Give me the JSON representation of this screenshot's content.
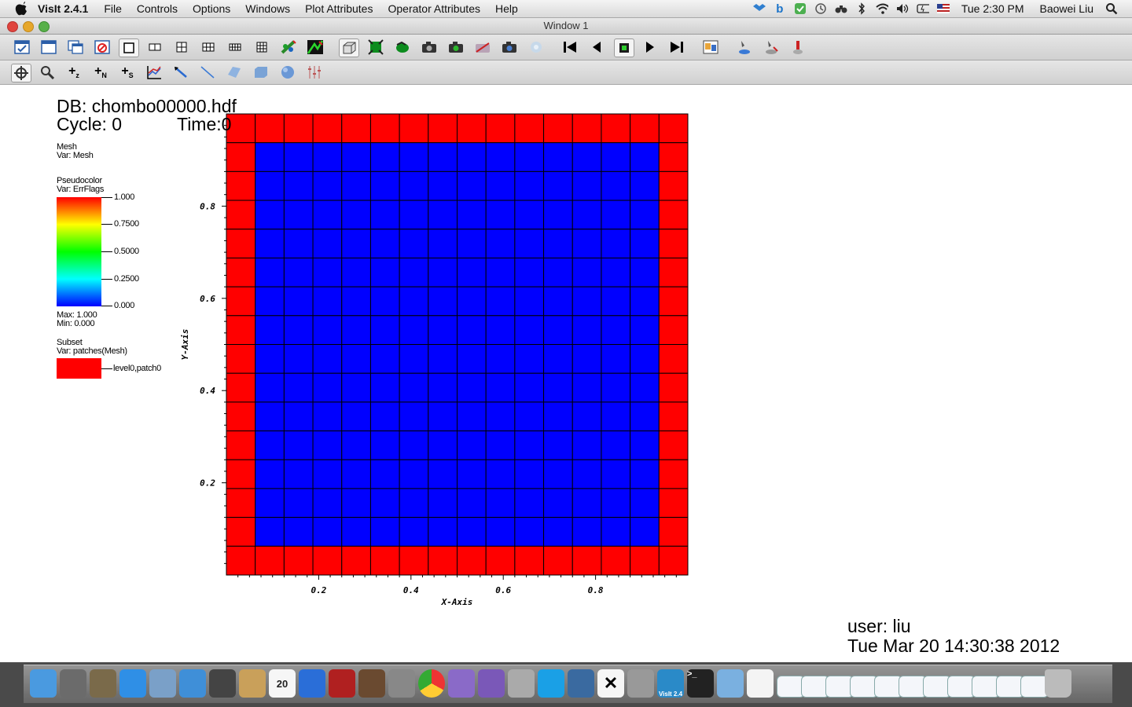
{
  "menubar": {
    "app_name": "VisIt 2.4.1",
    "items": [
      "File",
      "Controls",
      "Options",
      "Windows",
      "Plot Attributes",
      "Operator Attributes",
      "Help"
    ],
    "clock": "Tue 2:30 PM",
    "user": "Baowei Liu",
    "status_icons": [
      "dropbox-icon",
      "b-icon",
      "checkmark-icon",
      "time-machine-icon",
      "binoculars-icon",
      "bluetooth-icon",
      "wifi-icon",
      "volume-icon",
      "battery-icon",
      "flag-icon",
      "spotlight-icon"
    ]
  },
  "window": {
    "title": "Window 1"
  },
  "toolbar1": {
    "icons": [
      "active-window-icon",
      "new-window-icon",
      "clone-window-icon",
      "delete-window-icon",
      "layout-1x1-icon",
      "layout-1x2-icon",
      "layout-2x2-icon",
      "layout-2x3-icon",
      "layout-2x4-icon",
      "layout-3x3-icon",
      "lock-view-icon",
      "lock-time-icon",
      "3d-view-icon",
      "recenter-view-icon",
      "undo-view-icon",
      "save-image-icon",
      "camera-icon",
      "camera2-icon",
      "camera3-icon",
      "camera4-icon",
      "disabled-icon",
      "rewind-icon",
      "step-back-icon",
      "stop-icon",
      "play-icon",
      "step-forward-icon",
      "pick-icon",
      "tools1-icon",
      "tools2-icon",
      "tools3-icon"
    ]
  },
  "toolbar2": {
    "icons": [
      "navigate-icon",
      "zoom-icon",
      "zone-pick-icon",
      "node-pick-icon",
      "spreadsheet-pick-icon",
      "lineout-icon",
      "line-tool-icon",
      "line-icon",
      "plane-icon",
      "box-icon",
      "sphere-icon",
      "axis-icon"
    ]
  },
  "viz": {
    "db_line": "DB: chombo00000.hdf",
    "cycle_line": "Cycle: 0",
    "time_line": "Time:0",
    "legend_mesh": {
      "title": "Mesh",
      "var": "Var: Mesh"
    },
    "legend_pseudocolor": {
      "title": "Pseudocolor",
      "var": "Var: ErrFlags",
      "ticks": [
        "1.000",
        "0.7500",
        "0.5000",
        "0.2500",
        "0.000"
      ],
      "max": "Max:  1.000",
      "min": "Min:  0.000"
    },
    "legend_subset": {
      "title": "Subset",
      "var": "Var: patches(Mesh)",
      "entry": "level0,patch0",
      "color": "#ff0000"
    },
    "user_line": "user: liu",
    "date_line": "Tue Mar 20 14:30:38 2012"
  },
  "chart_data": {
    "type": "heatmap",
    "xlabel": "X-Axis",
    "ylabel": "Y-Axis",
    "xlim": [
      0,
      1
    ],
    "ylim": [
      0,
      1
    ],
    "x_ticks": [
      "0.2",
      "0.4",
      "0.6",
      "0.8"
    ],
    "y_ticks": [
      "0.2",
      "0.4",
      "0.6",
      "0.8"
    ],
    "grid_n": 16,
    "border_value": 1.0,
    "interior_value": 0.0,
    "high_color": "#ff0000",
    "low_color": "#0000ff"
  },
  "dock": {
    "icons": [
      "finder-icon",
      "launchpad-icon",
      "photo-booth-icon",
      "app-store-icon",
      "preview-icon",
      "safari-icon",
      "facetime-icon",
      "address-book-icon",
      "calendar-icon",
      "itunes-icon",
      "photo-strip-icon",
      "photo-icon",
      "system-preferences-icon",
      "chrome-icon",
      "mail-icon",
      "utility-icon",
      "tools-icon",
      "skype-icon",
      "iphoto-icon",
      "x11-icon",
      "calculator-icon",
      "visit-icon",
      "terminal-icon",
      "folder-icon",
      "document-icon",
      "window1-icon",
      "window2-icon",
      "window3-icon",
      "window4-icon",
      "window5-icon",
      "window6-icon",
      "window7-icon",
      "window8-icon",
      "window9-icon",
      "window10-icon",
      "window11-icon",
      "trash-icon"
    ],
    "calendar_day": "20",
    "visit_label": "VisIt 2.4"
  }
}
